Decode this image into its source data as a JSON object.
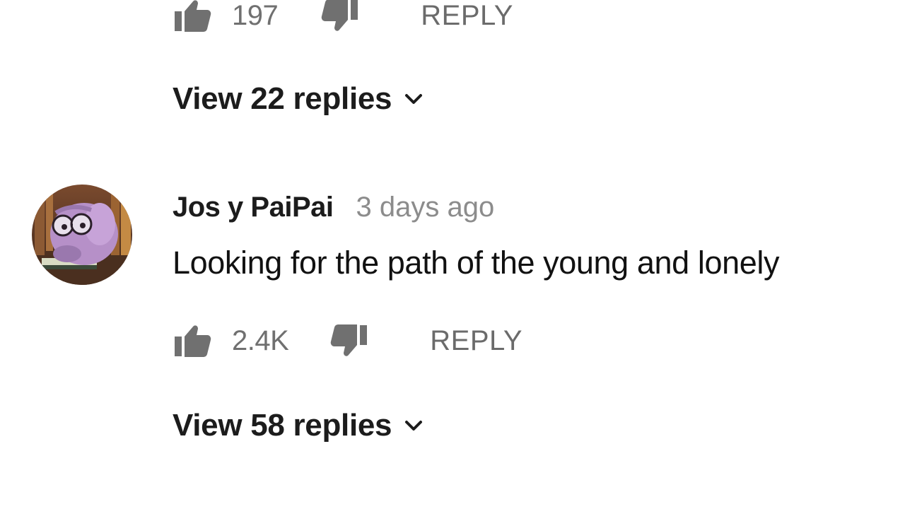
{
  "previous_comment": {
    "like_count": "197",
    "reply_label": "REPLY",
    "view_replies_label": "View 22 replies"
  },
  "comment": {
    "author": "Jos y PaiPai",
    "timestamp": "3 days ago",
    "text": "Looking for the path of the young and lonely",
    "like_count": "2.4K",
    "reply_label": "REPLY",
    "view_replies_label": "View 58 replies"
  },
  "icons": {
    "like": "thumbs-up-icon",
    "dislike": "thumbs-down-icon",
    "expand": "chevron-down-icon"
  },
  "colors": {
    "icon_gray": "#707070",
    "text_dark": "#1c1c1c",
    "text_muted": "#8c8c8c"
  }
}
